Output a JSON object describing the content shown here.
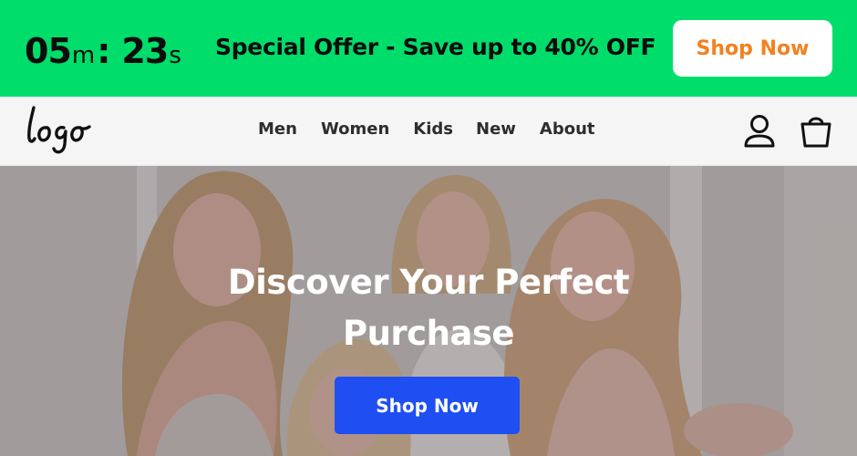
{
  "promo": {
    "timer": {
      "minutes": "05",
      "minutes_unit": "m",
      "separator": ":",
      "seconds": "23",
      "seconds_unit": "s"
    },
    "offer_text": "Special Offer - Save up to 40% OFF",
    "cta_label": "Shop Now"
  },
  "navbar": {
    "logo_text": "logo",
    "links": [
      "Men",
      "Women",
      "Kids",
      "New",
      "About"
    ],
    "icons": [
      "user-icon",
      "shopping-bag-icon"
    ]
  },
  "hero": {
    "title_line1": "Discover Your Perfect",
    "title_line2": "Purchase",
    "cta_label": "Shop Now"
  },
  "colors": {
    "promo_bg": "#00dd6a",
    "promo_cta_text": "#f4801f",
    "hero_cta_bg": "#1f4ff2",
    "navbar_bg": "#f5f5f5"
  }
}
